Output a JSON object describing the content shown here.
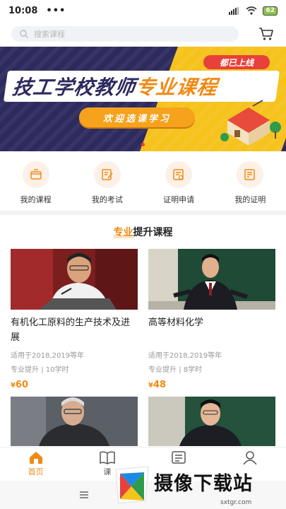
{
  "status": {
    "time": "10:08",
    "dots": "•••",
    "battery": "62"
  },
  "search": {
    "placeholder": "搜索课程"
  },
  "banner": {
    "title_main": "技工学校教师",
    "title_accent": "专业课程",
    "tag": "都已上线",
    "button": "欢迎选课学习"
  },
  "quick_links": [
    {
      "label": "我的课程",
      "icon": "course-icon"
    },
    {
      "label": "我的考试",
      "icon": "exam-icon"
    },
    {
      "label": "证明申请",
      "icon": "certificate-apply-icon"
    },
    {
      "label": "我的证明",
      "icon": "certificate-icon"
    }
  ],
  "section": {
    "title_highlight": "专业",
    "title_rest": "提升课程"
  },
  "courses": [
    {
      "name": "有机化工原料的生产技术及进展",
      "for": "适用于2018,2019等年",
      "category": "专业提升",
      "hours": "10学时",
      "currency": "¥",
      "price": "60"
    },
    {
      "name": "高等材料化学",
      "for": "适用于2018,2019等年",
      "category": "专业提升",
      "hours": "8学时",
      "currency": "¥",
      "price": "48"
    }
  ],
  "tabs": [
    {
      "label": "首页",
      "icon": "home-icon",
      "active": true
    },
    {
      "label": "课",
      "icon": "book-icon",
      "active": false
    },
    {
      "label": "",
      "icon": "news-icon",
      "active": false
    },
    {
      "label": "",
      "icon": "user-icon",
      "active": false
    }
  ],
  "watermark": {
    "text": "摄像下载站",
    "url": "sxtgr.com"
  },
  "colors": {
    "accent": "#f08a14",
    "banner_dark": "#2d2a5e",
    "banner_yellow": "#f6c21c"
  }
}
